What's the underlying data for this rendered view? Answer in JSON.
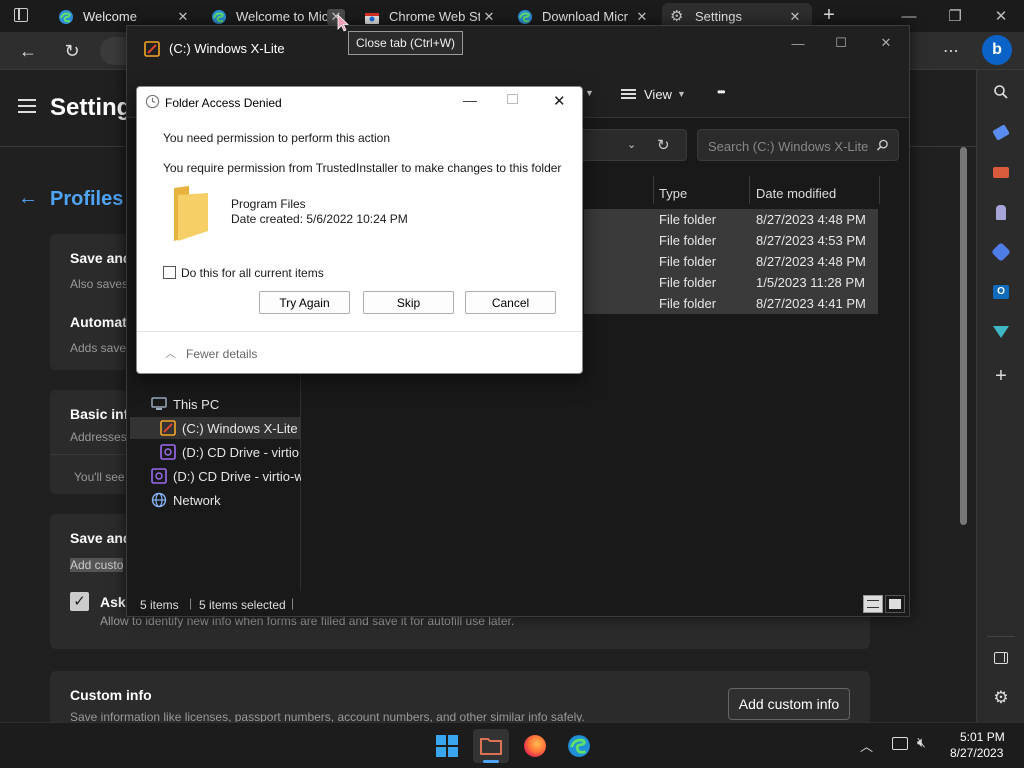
{
  "browser": {
    "tabs": [
      {
        "label": "Welcome",
        "icon": "edge-icon"
      },
      {
        "label": "Welcome to Mic",
        "icon": "edge-icon"
      },
      {
        "label": "Chrome Web St",
        "icon": "chrome-web-store-icon"
      },
      {
        "label": "Download Micr",
        "icon": "edge-icon"
      },
      {
        "label": "Settings",
        "icon": "gear-icon"
      }
    ],
    "new_tab_glyph": "+",
    "tooltip": "Close tab (Ctrl+W)"
  },
  "settings_page": {
    "title": "Setting",
    "breadcrumb": "Profiles",
    "cards": [
      {
        "title": "Save and",
        "subtitle": "Also saves"
      },
      {
        "title": "Automat",
        "subtitle": "Adds save"
      },
      {
        "title": "Basic info",
        "subtitle": "Addresses",
        "extra": "You'll see"
      },
      {
        "title": "Save and",
        "subtitle": "Add custo"
      },
      {
        "checkbox_label": "Ask",
        "checkbox_sub": "Allow to identify new info when forms are filled and save it for autofill use later."
      },
      {
        "title": "Custom info",
        "subtitle": "Save information like licenses, passport numbers, account numbers, and other similar info safely.",
        "button": "Add custom info"
      }
    ]
  },
  "explorer": {
    "title": "(C:) Windows X-Lite",
    "view_label": "View",
    "more_glyph": "•••",
    "search_placeholder": "Search (C:) Windows X-Lite",
    "columns": {
      "type": "Type",
      "date": "Date modified"
    },
    "rows": [
      {
        "type": "File folder",
        "date": "8/27/2023 4:48 PM"
      },
      {
        "type": "File folder",
        "date": "8/27/2023 4:53 PM"
      },
      {
        "type": "File folder",
        "date": "8/27/2023 4:48 PM"
      },
      {
        "type": "File folder",
        "date": "1/5/2023 11:28 PM"
      },
      {
        "type": "File folder",
        "date": "8/27/2023 4:41 PM"
      }
    ],
    "tree": [
      {
        "label": "This PC"
      },
      {
        "label": "(C:) Windows X-Lite"
      },
      {
        "label": "(D:) CD Drive - virtio"
      },
      {
        "label": "(D:) CD Drive - virtio-w"
      },
      {
        "label": "Network"
      }
    ],
    "status": {
      "items": "5 items",
      "selected": "5 items selected"
    }
  },
  "dialog": {
    "title": "Folder Access Denied",
    "heading": "You need permission to perform this action",
    "message": "You require permission from TrustedInstaller to make changes to this folder",
    "item_name": "Program Files",
    "item_date": "Date created: 5/6/2022 10:24 PM",
    "checkbox_label": "Do this for all current items",
    "buttons": {
      "retry": "Try Again",
      "skip": "Skip",
      "cancel": "Cancel"
    },
    "details_toggle": "Fewer details"
  },
  "taskbar": {
    "time": "5:01 PM",
    "date": "8/27/2023"
  },
  "colors": {
    "accent": "#4ea4f5",
    "folder": "#f3c557",
    "selection": "#3a3a3a"
  }
}
